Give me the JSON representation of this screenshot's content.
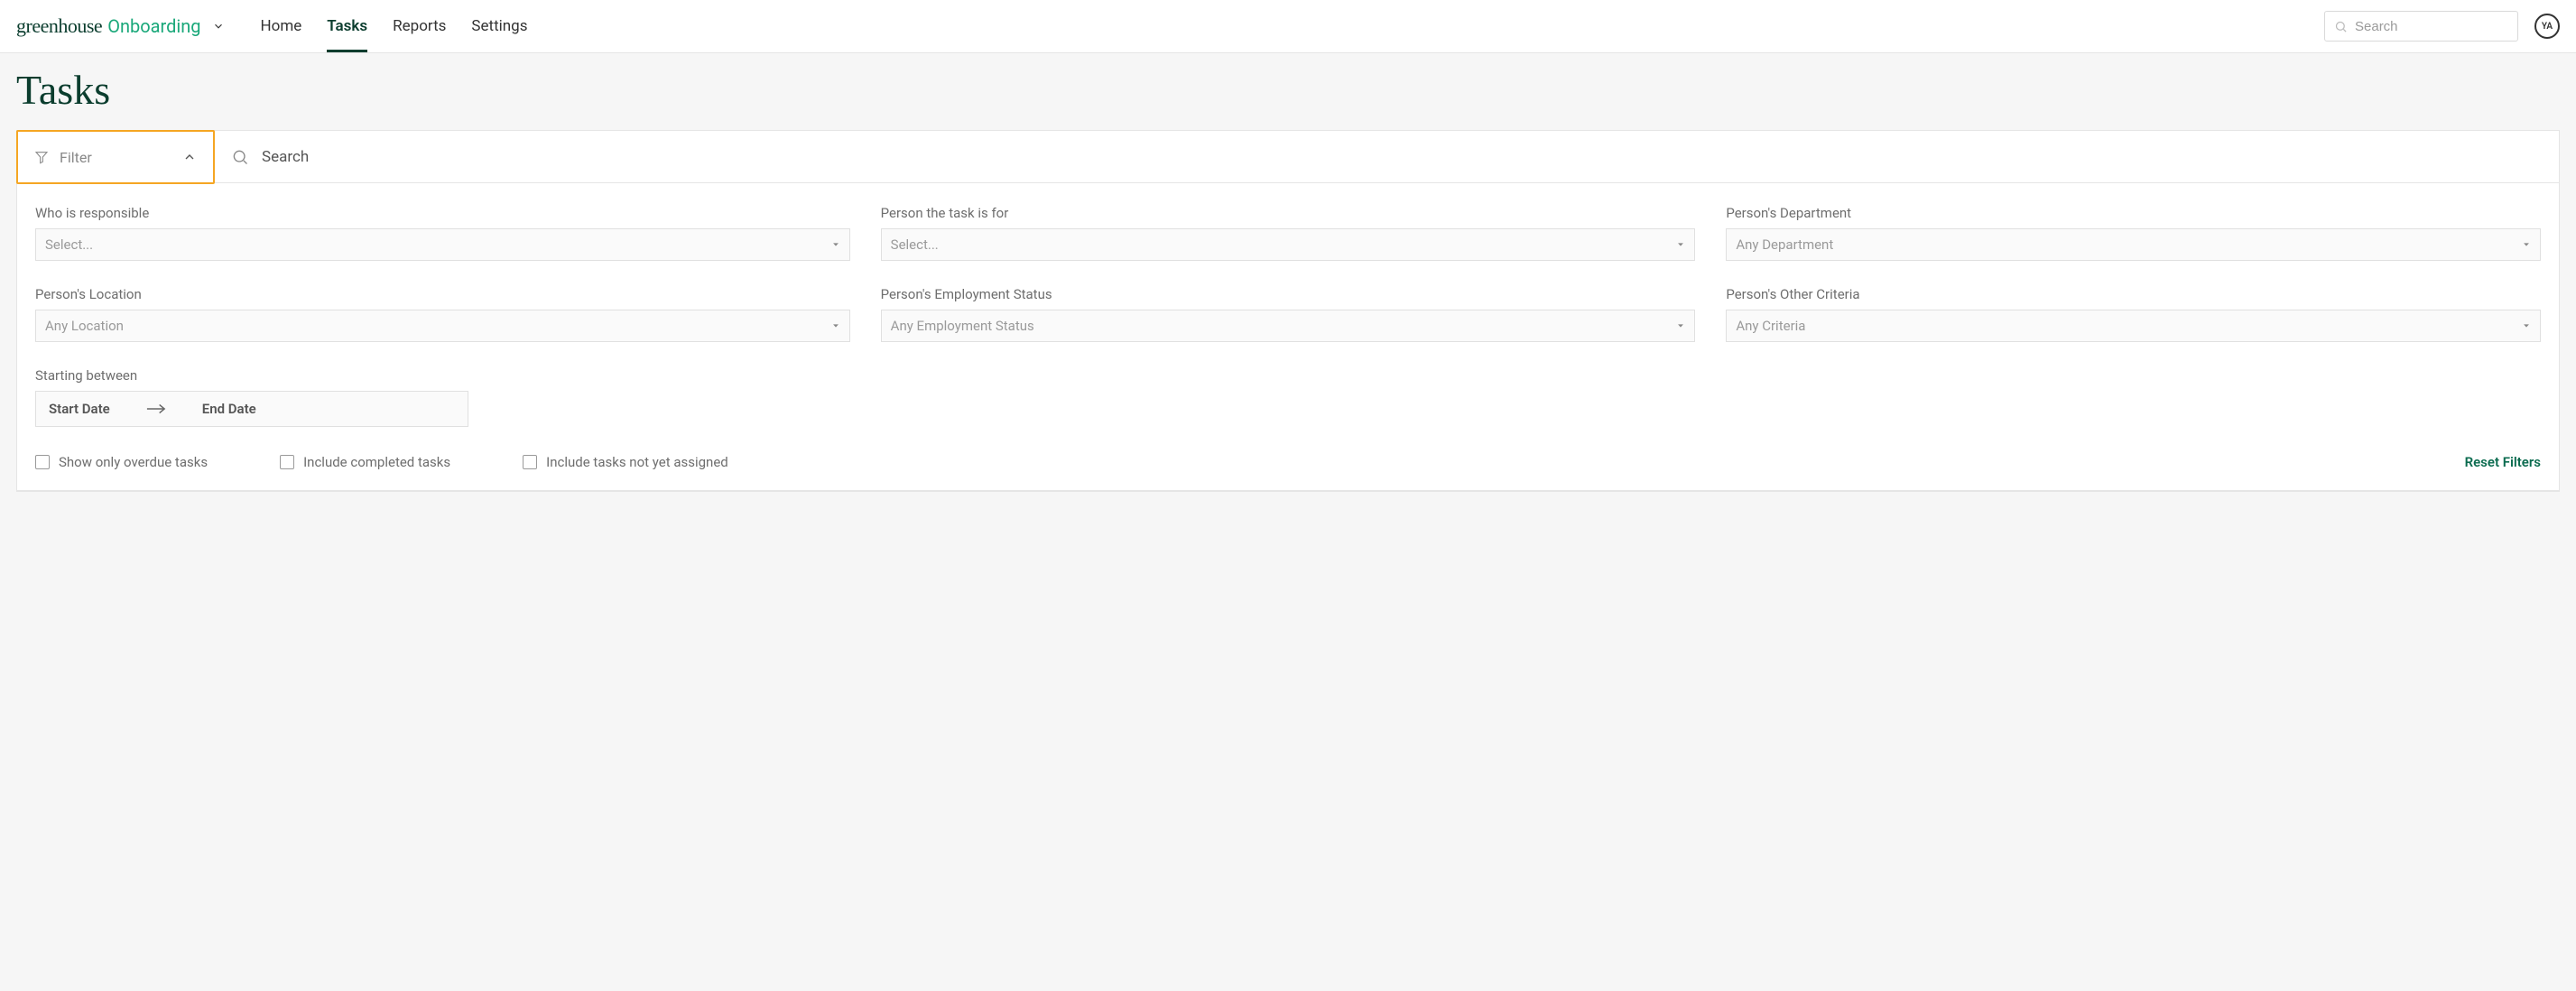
{
  "brand": {
    "part1": "greenhouse",
    "part2": "Onboarding"
  },
  "nav": {
    "items": [
      {
        "label": "Home",
        "active": false
      },
      {
        "label": "Tasks",
        "active": true
      },
      {
        "label": "Reports",
        "active": false
      },
      {
        "label": "Settings",
        "active": false
      }
    ]
  },
  "top_search": {
    "placeholder": "Search"
  },
  "avatar": {
    "initials": "YA"
  },
  "page": {
    "title": "Tasks"
  },
  "filter_toggle": {
    "label": "Filter"
  },
  "panel_search": {
    "label": "Search"
  },
  "filters": {
    "responsible": {
      "label": "Who is responsible",
      "placeholder": "Select..."
    },
    "person_for": {
      "label": "Person the task is for",
      "placeholder": "Select..."
    },
    "department": {
      "label": "Person's Department",
      "placeholder": "Any Department"
    },
    "location": {
      "label": "Person's Location",
      "placeholder": "Any Location"
    },
    "emp_status": {
      "label": "Person's Employment Status",
      "placeholder": "Any Employment Status"
    },
    "other": {
      "label": "Person's Other Criteria",
      "placeholder": "Any Criteria"
    },
    "starting": {
      "label": "Starting between",
      "start": "Start Date",
      "end": "End Date"
    }
  },
  "checkboxes": {
    "overdue": {
      "label": "Show only overdue tasks"
    },
    "completed": {
      "label": "Include completed tasks"
    },
    "unassigned": {
      "label": "Include tasks not yet assigned"
    }
  },
  "reset": {
    "label": "Reset Filters"
  }
}
